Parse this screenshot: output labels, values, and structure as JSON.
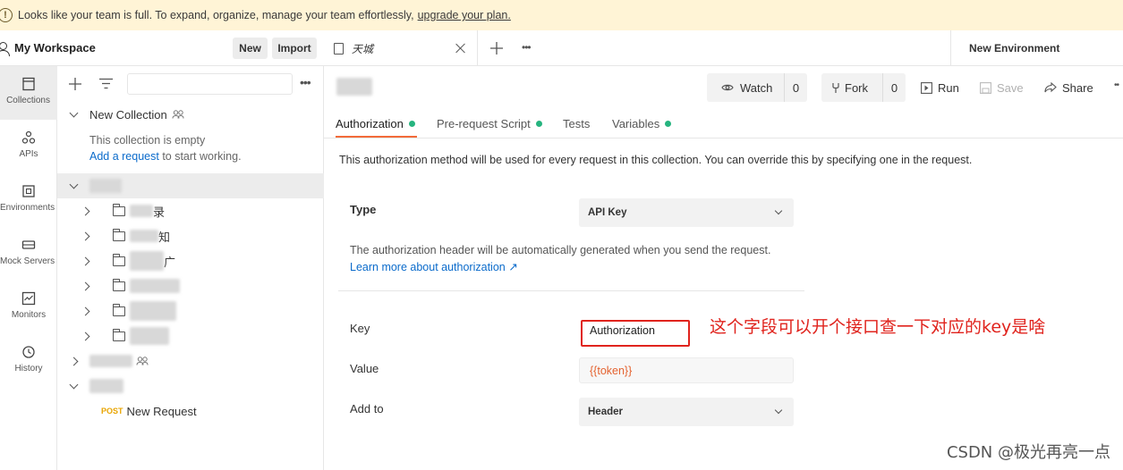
{
  "banner": {
    "text": "Looks like your team is full. To expand, organize, manage your team effortlessly,",
    "link": "upgrade your plan."
  },
  "workspace": {
    "title": "My Workspace",
    "new_label": "New",
    "import_label": "Import"
  },
  "rail": {
    "items": [
      {
        "label": "Collections",
        "icon": "collections-icon",
        "active": true
      },
      {
        "label": "APIs",
        "icon": "apis-icon"
      },
      {
        "label": "Environments",
        "icon": "environments-icon"
      },
      {
        "label": "Mock Servers",
        "icon": "mock-servers-icon"
      },
      {
        "label": "Monitors",
        "icon": "monitors-icon"
      },
      {
        "label": "History",
        "icon": "history-icon"
      }
    ]
  },
  "tree": {
    "new_collection": "New Collection",
    "empty_text": "This collection is empty",
    "add_request_link": "Add a request",
    "add_request_suffix": " to start working.",
    "folder_suffixes": [
      "录",
      "知",
      "广",
      "",
      "",
      ""
    ],
    "post_method": "POST",
    "new_request": "New Request"
  },
  "tabs": {
    "request_tab_title": "天城",
    "environment": "New Environment"
  },
  "toolbar": {
    "watch_label": "Watch",
    "watch_count": "0",
    "fork_label": "Fork",
    "fork_count": "0",
    "run_label": "Run",
    "save_label": "Save",
    "share_label": "Share"
  },
  "subtabs": {
    "authorization": "Authorization",
    "prerequest": "Pre-request Script",
    "tests": "Tests",
    "variables": "Variables"
  },
  "auth": {
    "description": "This authorization method will be used for every request in this collection. You can override this by specifying one in the request.",
    "type_label": "Type",
    "type_value": "API Key",
    "header_note": "The authorization header will be automatically generated when you send the request.",
    "learn_more": "Learn more about authorization ↗",
    "key_label": "Key",
    "key_value": "Authorization",
    "value_label": "Value",
    "value_value": "{{token}}",
    "addto_label": "Add to",
    "addto_value": "Header"
  },
  "annotation": "这个字段可以开个接口查一下对应的key是啥",
  "watermark": "CSDN @极光再亮一点",
  "colors": {
    "banner_bg": "#fff4d6",
    "accent": "#f26b3a",
    "green_dot": "#26b47f",
    "link": "#0b6bcb",
    "annotation": "#e0231d"
  }
}
